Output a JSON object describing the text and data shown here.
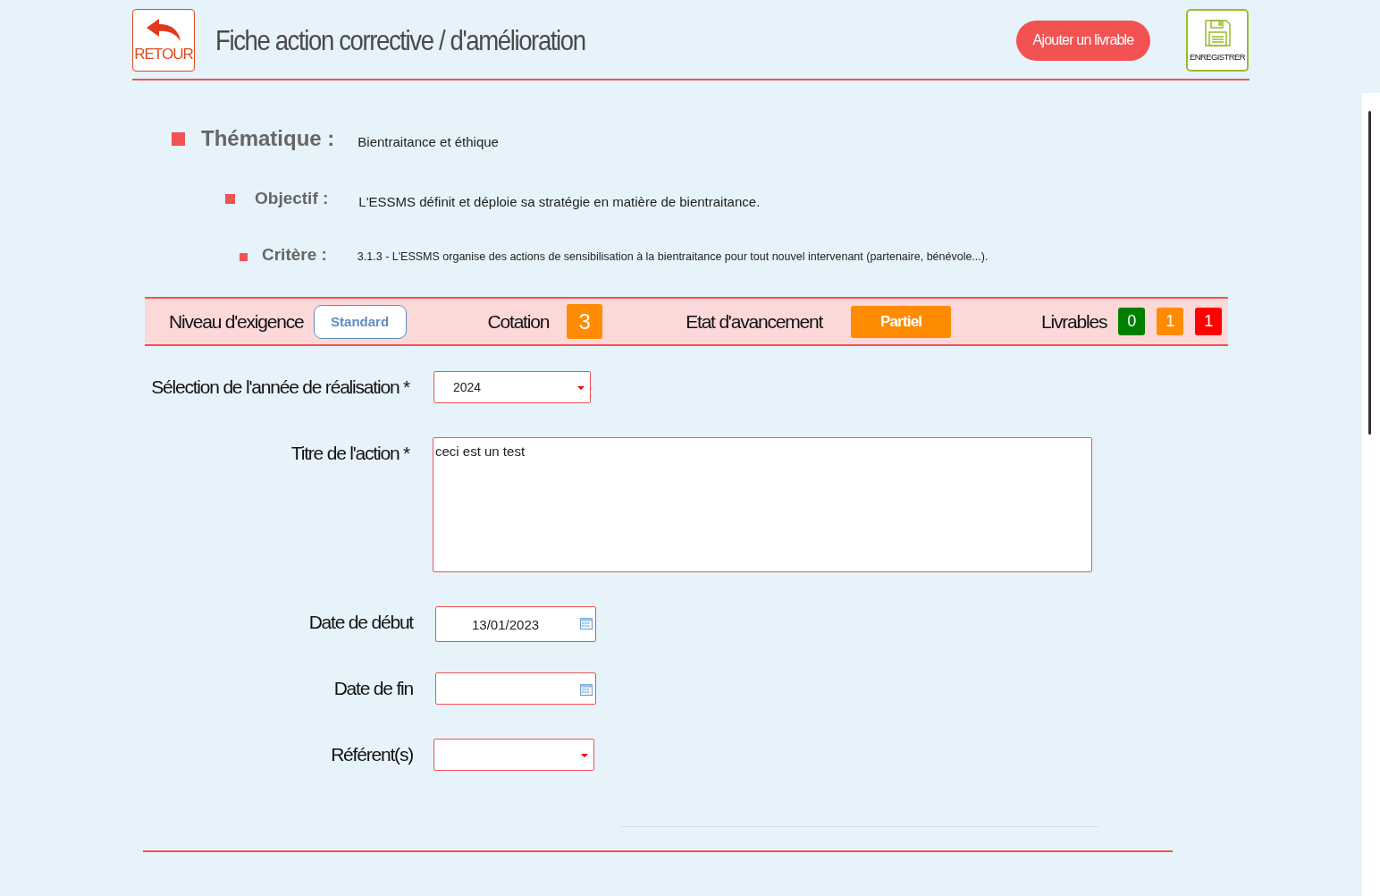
{
  "header": {
    "back_button": "RETOUR",
    "title": "Fiche action corrective / d'amélioration",
    "add_button": "Ajouter un livrable",
    "save_button": "ENREGISTRER"
  },
  "context": [
    {
      "label": "Thématique :",
      "value": "Bientraitance et éthique"
    },
    {
      "label": "Objectif :",
      "value": "L'ESSMS définit et déploie sa stratégie en matière de bientraitance."
    },
    {
      "label": "Critère :",
      "value": "3.1.3 - L'ESSMS organise des actions de sensibilisation à la bientraitance pour tout nouvel intervenant (partenaire, bénévole...)."
    }
  ],
  "summary": {
    "level_label": "Niveau d'exigence",
    "level_value": "Standard",
    "cotation_label": "Cotation",
    "cotation_value": "3",
    "progress_label": "Etat d'avancement",
    "progress_value": "Partiel",
    "deliverables_label": "Livrables",
    "deliverables": [
      {
        "count": "0",
        "color": "#008000"
      },
      {
        "count": "1",
        "color": "#ff8c00"
      },
      {
        "count": "1",
        "color": "#ff0000"
      }
    ]
  },
  "form": [
    {
      "kind": "select",
      "label": "Sélection de l'année de réalisation *",
      "value": "2024"
    },
    {
      "kind": "textarea",
      "label": "Titre de l'action *",
      "value": "ceci est un test"
    },
    {
      "kind": "date",
      "label": "Date de début",
      "value": "13/01/2023"
    },
    {
      "kind": "date",
      "label": "Date de fin"
    },
    {
      "kind": "select",
      "label": "Référent(s)"
    }
  ]
}
